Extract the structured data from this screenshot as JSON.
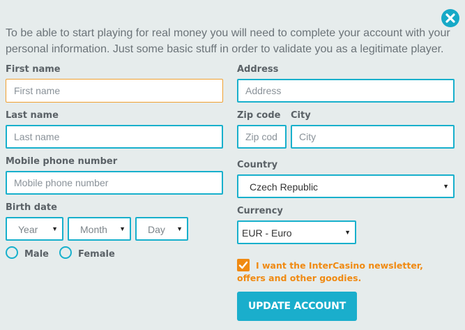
{
  "intro_text": "To be able to start playing for real money you will need to complete your account with your personal information. Just some basic stuff in order to validate you as a legitimate player.",
  "first_name": {
    "label": "First name",
    "placeholder": "First name"
  },
  "last_name": {
    "label": "Last name",
    "placeholder": "Last name"
  },
  "mobile": {
    "label": "Mobile phone number",
    "placeholder": "Mobile phone number"
  },
  "birth_date": {
    "label": "Birth date",
    "year": "Year",
    "month": "Month",
    "day": "Day"
  },
  "gender": {
    "male": "Male",
    "female": "Female"
  },
  "address": {
    "label": "Address",
    "placeholder": "Address"
  },
  "zip": {
    "label": "Zip code",
    "placeholder": "Zip cod"
  },
  "city": {
    "label": "City",
    "placeholder": "City"
  },
  "country": {
    "label": "Country",
    "value": "Czech Republic"
  },
  "currency": {
    "label": "Currency",
    "value": "EUR - Euro"
  },
  "newsletter": {
    "text": "I want the InterCasino newsletter, offers and other goodies.",
    "checked": true
  },
  "submit_label": "UPDATE ACCOUNT",
  "colors": {
    "accent": "#18b0cc",
    "orange": "#f08a12",
    "background": "#e6ecec",
    "focus": "#f0a030"
  },
  "icons": {
    "close": "close-icon",
    "caret": "caret-down-icon",
    "check": "checkmark-icon"
  }
}
